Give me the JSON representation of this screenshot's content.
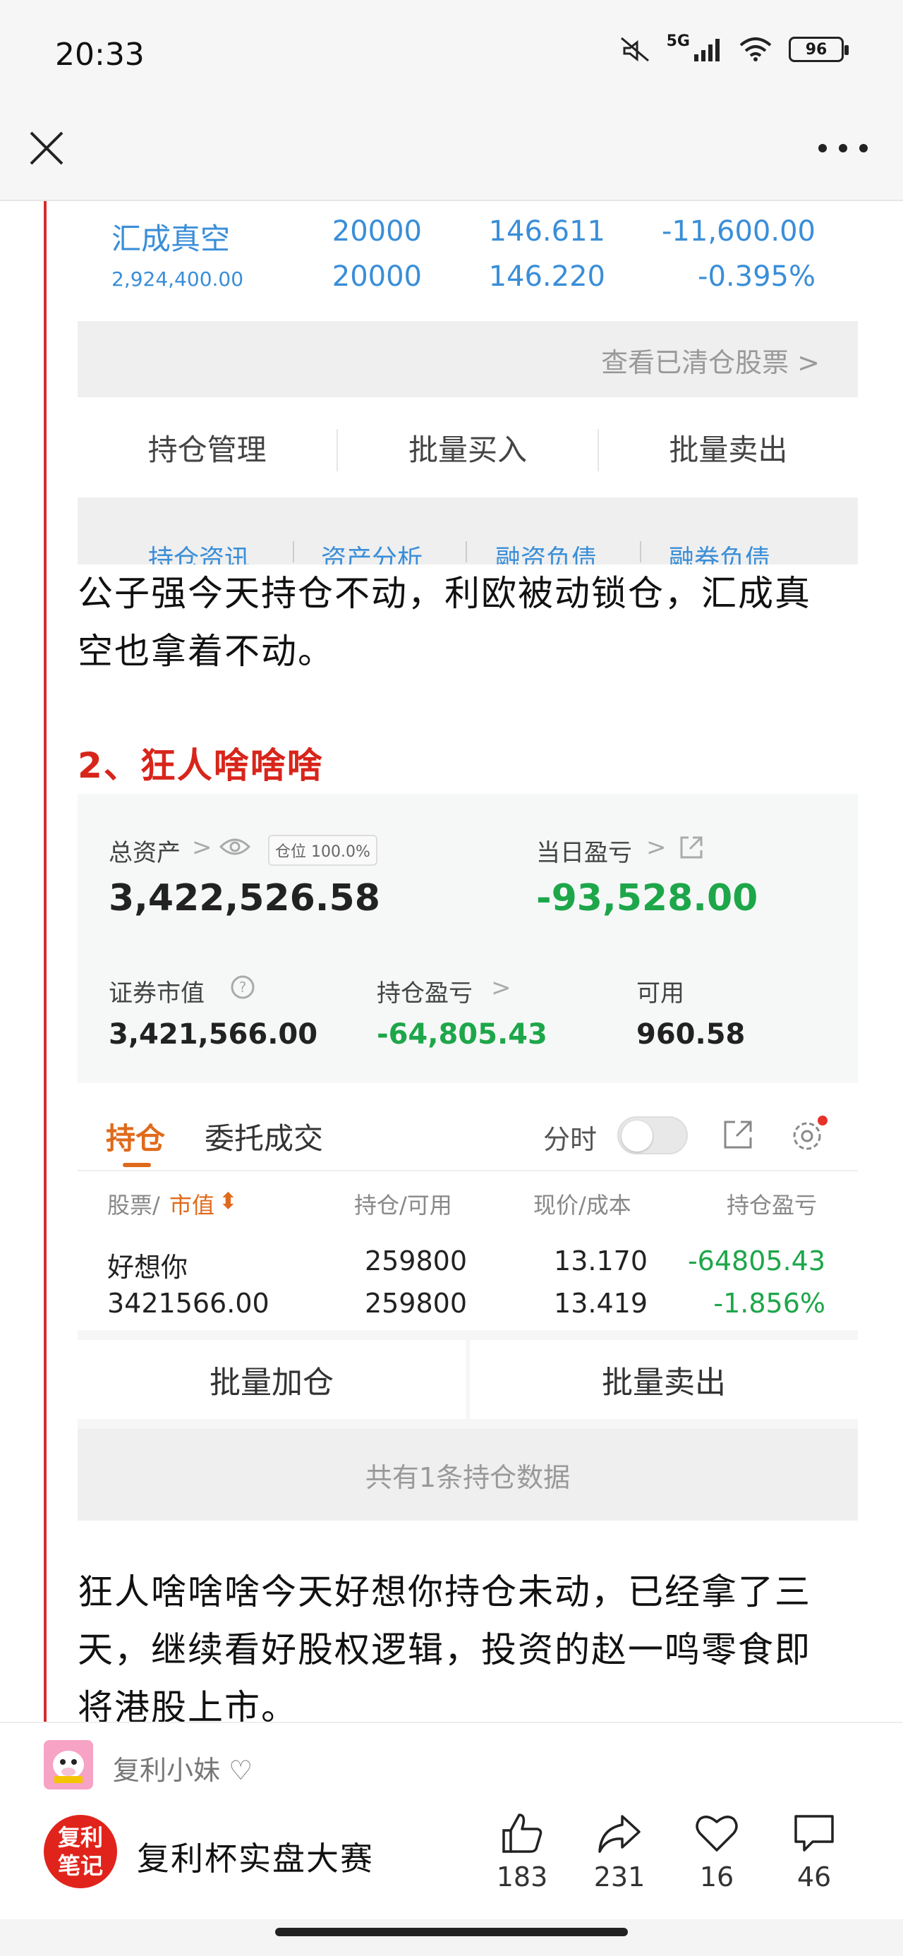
{
  "status": {
    "time": "20:33",
    "network": "5G",
    "battery": "96"
  },
  "shot1": {
    "name": "汇成真空",
    "qty1": "20000",
    "price1": "146.611",
    "pnl": "-11,600.00",
    "value": "2,924,400.00",
    "qty2": "20000",
    "price2": "146.220",
    "pct": "-0.395%",
    "cleared_link": "查看已清仓股票 >",
    "actions": [
      "持仓管理",
      "批量买入",
      "批量卖出"
    ],
    "tabs": [
      "持仓资讯",
      "资产分析",
      "融资负债",
      "融券负债"
    ]
  },
  "para1": "公子强今天持仓不动，利欧被动锁仓，汇成真空也拿着不动。",
  "section2_title": "2、狂人啥啥啥",
  "shot2": {
    "total_assets_label": "总资产",
    "position_ratio": "仓位 100.0%",
    "total_assets": "3,422,526.58",
    "daily_pnl_label": "当日盈亏",
    "daily_pnl": "-93,528.00",
    "market_value_label": "证券市值",
    "market_value": "3,421,566.00",
    "holding_pnl_label": "持仓盈亏",
    "holding_pnl": "-64,805.43",
    "available_label": "可用",
    "available": "960.58",
    "tab_holdings": "持仓",
    "tab_orders": "委托成交",
    "timeshare_label": "分时",
    "col_stock": "股票/",
    "col_mv": "市值",
    "col_qty": "持仓/可用",
    "col_price": "现价/成本",
    "col_pnl": "持仓盈亏",
    "row": {
      "name": "好想你",
      "value": "3421566.00",
      "qty": "259800",
      "avail": "259800",
      "price": "13.170",
      "cost": "13.419",
      "pnl": "-64805.43",
      "pct": "-1.856%"
    },
    "btn_add": "批量加仓",
    "btn_sell": "批量卖出",
    "count_text": "共有1条持仓数据"
  },
  "para2": "狂人啥啥啥今天好想你持仓未动，已经拿了三天，继续看好股权逻辑，投资的赵一鸣零食即将港股上市。",
  "author": {
    "name": "复利小妹 ♡"
  },
  "brand": {
    "logo": "复利笔记",
    "name": "复利杯实盘大赛"
  },
  "actions": {
    "like": "183",
    "share": "231",
    "favorite": "16",
    "comment": "46"
  },
  "colors": {
    "accent_red": "#d8251b",
    "gain_green": "#1ea64a",
    "link_blue": "#3a8ed8",
    "tab_orange": "#e06a1b"
  }
}
